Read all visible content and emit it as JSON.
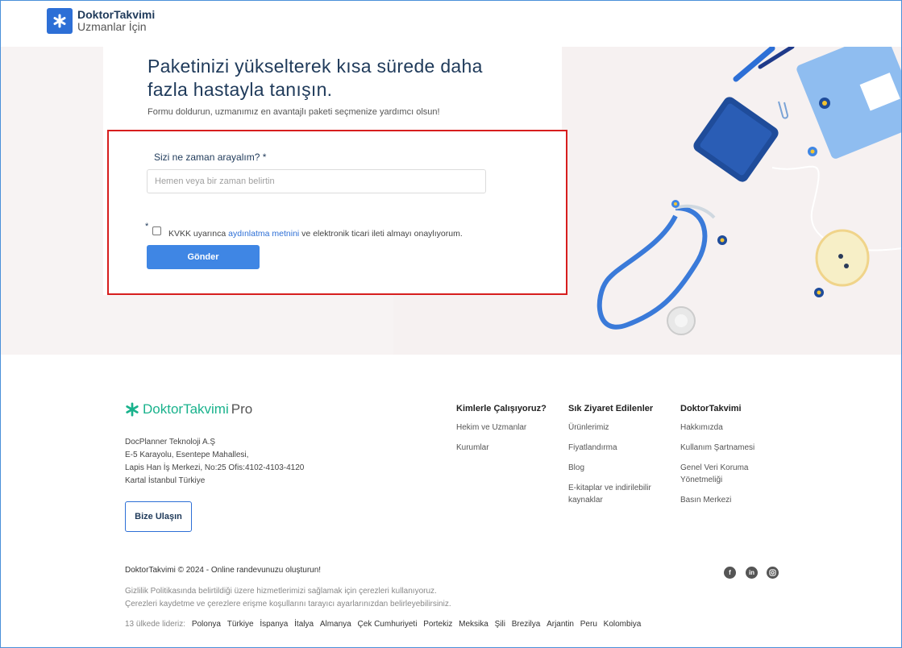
{
  "header": {
    "logo_title": "DoktorTakvimi",
    "logo_subtitle": "Uzmanlar İçin"
  },
  "hero": {
    "headline": "Paketinizi yükselterek kısa sürede daha fazla hastayla tanışın.",
    "subline": "Formu doldurun, uzmanımız en avantajlı paketi seçmenize yardımcı olsun!"
  },
  "form": {
    "time_label": "Sizi ne zaman arayalım?  *",
    "time_placeholder": "Hemen veya bir zaman belirtin",
    "required_marker": "*",
    "consent_before": "KVKK uyarınca ",
    "consent_link": "aydınlatma metnini",
    "consent_after": " ve elektronik ticari ileti almayı onaylıyorum.",
    "submit_label": "Gönder"
  },
  "footer": {
    "brand": "DoktorTakvimi",
    "brand_suffix": "Pro",
    "address": [
      "DocPlanner Teknoloji A.Ş",
      "E-5 Karayolu, Esentepe Mahallesi,",
      "Lapis Han İş Merkezi, No:25 Ofis:4102-4103-4120",
      "Kartal İstanbul Türkiye"
    ],
    "contact_button": "Bize Ulaşın",
    "columns": [
      {
        "title": "Kimlerle Çalışıyoruz?",
        "links": [
          "Hekim ve Uzmanlar",
          "Kurumlar"
        ]
      },
      {
        "title": "Sık Ziyaret Edilenler",
        "links": [
          "Ürünlerimiz",
          "Fiyatlandırma",
          "Blog",
          "E-kitaplar ve indirilebilir kaynaklar"
        ]
      },
      {
        "title": "DoktorTakvimi",
        "links": [
          "Hakkımızda",
          "Kullanım Şartnamesi",
          "Genel Veri Koruma Yönetmeliği",
          "Basın Merkezi"
        ]
      }
    ],
    "copyright": "DoktorTakvimi © 2024 - Online randevunuzu oluşturun!",
    "cookie_line1": "Gizlilik Politikasında belirtildiği üzere hizmetlerimizi sağlamak için çerezleri kullanıyoruz.",
    "cookie_line2": "Çerezleri kaydetme ve çerezlere erişme koşullarını tarayıcı ayarlarınızdan belirleyebilirsiniz.",
    "countries_label": "13 ülkede lideriz:",
    "countries": [
      "Polonya",
      "Türkiye",
      "İspanya",
      "İtalya",
      "Almanya",
      "Çek Cumhuriyeti",
      "Portekiz",
      "Meksika",
      "Şili",
      "Brezilya",
      "Arjantin",
      "Peru",
      "Kolombiya"
    ],
    "social_icons": [
      "facebook-icon",
      "linkedin-icon",
      "instagram-icon"
    ]
  },
  "colors": {
    "brand_blue": "#2d6fd6",
    "pro_green": "#19b28c",
    "highlight_red": "#d71e1e",
    "button_blue": "#3f86e4"
  }
}
